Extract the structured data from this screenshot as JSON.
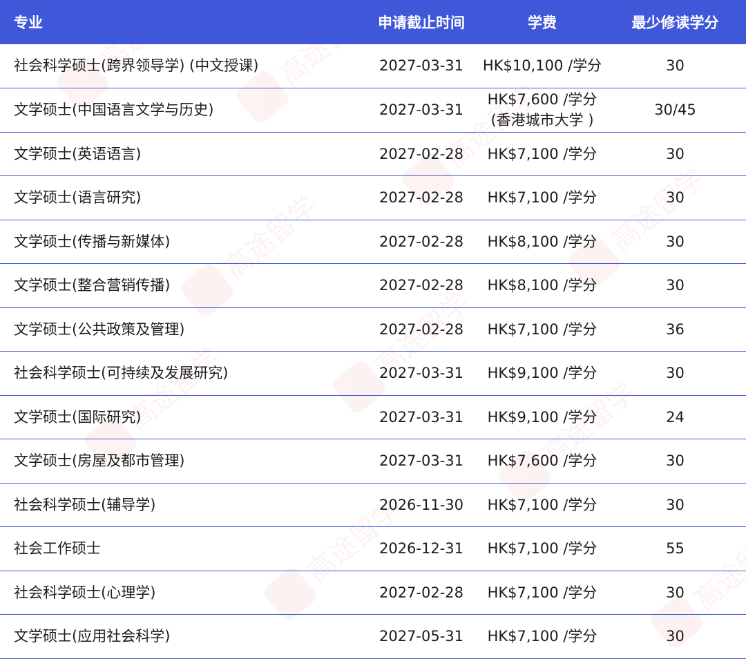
{
  "header": {
    "major": "专业",
    "deadline": "申请截止时间",
    "tuition": "学费",
    "min_credits": "最少修读学分"
  },
  "rows": [
    {
      "major": "社会科学硕士(跨界领导学) (中文授课)",
      "deadline": "2027-03-31",
      "tuition": "HK$10,100 /学分",
      "tuition_note": "",
      "credits": "30"
    },
    {
      "major": "文学硕士(中国语言文学与历史)",
      "deadline": "2027-03-31",
      "tuition": "HK$7,600 /学分",
      "tuition_note": "(香港城市大学 )",
      "credits": "30/45"
    },
    {
      "major": "文学硕士(英语语言)",
      "deadline": "2027-02-28",
      "tuition": "HK$7,100 /学分",
      "tuition_note": "",
      "credits": "30"
    },
    {
      "major": "文学硕士(语言研究)",
      "deadline": "2027-02-28",
      "tuition": "HK$7,100 /学分",
      "tuition_note": "",
      "credits": "30"
    },
    {
      "major": "文学硕士(传播与新媒体)",
      "deadline": "2027-02-28",
      "tuition": "HK$8,100 /学分",
      "tuition_note": "",
      "credits": "30"
    },
    {
      "major": "文学硕士(整合营销传播)",
      "deadline": "2027-02-28",
      "tuition": "HK$8,100 /学分",
      "tuition_note": "",
      "credits": "30"
    },
    {
      "major": "文学硕士(公共政策及管理)",
      "deadline": "2027-02-28",
      "tuition": "HK$7,100 /学分",
      "tuition_note": "",
      "credits": "36"
    },
    {
      "major": "社会科学硕士(可持续及发展研究)",
      "deadline": "2027-03-31",
      "tuition": "HK$9,100 /学分",
      "tuition_note": "",
      "credits": "30"
    },
    {
      "major": "文学硕士(国际研究)",
      "deadline": "2027-03-31",
      "tuition": "HK$9,100 /学分",
      "tuition_note": "",
      "credits": "24"
    },
    {
      "major": "文学硕士(房屋及都市管理)",
      "deadline": "2027-03-31",
      "tuition": "HK$7,600 /学分",
      "tuition_note": "",
      "credits": "30"
    },
    {
      "major": "社会科学硕士(辅导学)",
      "deadline": "2026-11-30",
      "tuition": "HK$7,100 /学分",
      "tuition_note": "",
      "credits": "30"
    },
    {
      "major": "社会工作硕士",
      "deadline": "2026-12-31",
      "tuition": "HK$7,100 /学分",
      "tuition_note": "",
      "credits": "55"
    },
    {
      "major": "社会科学硕士(心理学)",
      "deadline": "2027-02-28",
      "tuition": "HK$7,100 /学分",
      "tuition_note": "",
      "credits": "30"
    },
    {
      "major": "文学硕士(应用社会科学)",
      "deadline": "2027-05-31",
      "tuition": "HK$7,100 /学分",
      "tuition_note": "",
      "credits": "30"
    }
  ],
  "watermark": {
    "text": "高途留学",
    "color": "#f08a8a"
  },
  "colors": {
    "header_bg": "#3f57d8",
    "divider": "#3f57d8"
  }
}
